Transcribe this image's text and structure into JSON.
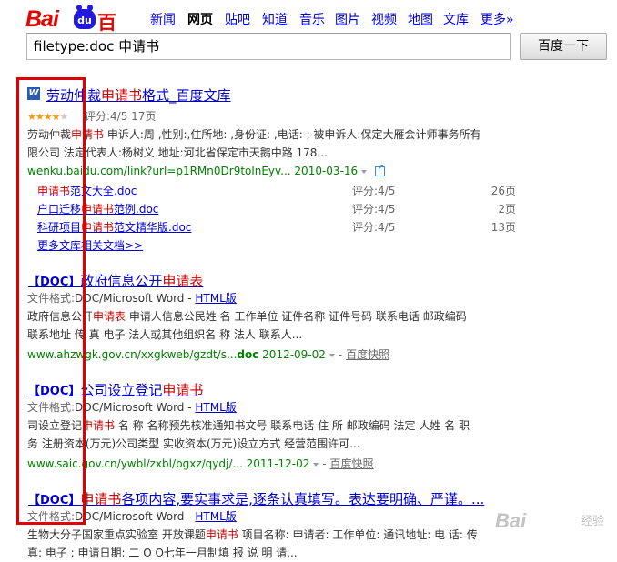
{
  "logo": {
    "bai": "Bai",
    "du": "百度",
    "paw_text": "du"
  },
  "nav": [
    {
      "label": "新闻",
      "current": false
    },
    {
      "label": "网页",
      "current": true
    },
    {
      "label": "贴吧",
      "current": false
    },
    {
      "label": "知道",
      "current": false
    },
    {
      "label": "音乐",
      "current": false
    },
    {
      "label": "图片",
      "current": false
    },
    {
      "label": "视频",
      "current": false
    },
    {
      "label": "地图",
      "current": false
    },
    {
      "label": "文库",
      "current": false
    },
    {
      "label": "更多»",
      "current": false
    }
  ],
  "search": {
    "value": "filetype:doc 申请书",
    "button": "百度一下"
  },
  "result1": {
    "title_pre": "劳动仲裁",
    "title_em": "申请书",
    "title_post": "格式_百度文库",
    "rating": "评分:4/5 17页",
    "stars": {
      "value": 4,
      "max": 5
    },
    "line1_pre": "劳动仲裁",
    "line1_em": "申请书",
    "line1_post": " 申诉人:周 ,性别:,住所地: ,身份证: ,电话: ; 被申诉人:保定大雁会计师事务所有",
    "line2": "限公司 法定代表人:杨树义 地址:河北省保定市天鹅中路 178...",
    "url": "wenku.baidu.com/link?url=p1RMn0Dr9tolnEyv... 2010-03-16",
    "sub": [
      {
        "t_pre": "",
        "t_em": "申请书",
        "t_post": "范文大全.doc",
        "score": "评分:4/5",
        "pages": "26页"
      },
      {
        "t_pre": "户口迁移",
        "t_em": "申请书",
        "t_post": "范例.doc",
        "score": "评分:4/5",
        "pages": "2页"
      },
      {
        "t_pre": "科研项目",
        "t_em": "申请书",
        "t_post": "范文精华版.doc",
        "score": "评分:4/5",
        "pages": "13页"
      }
    ],
    "more": "更多文库相关文档>>"
  },
  "doc_tag": "【DOC】",
  "result2": {
    "title_pre": "政府信息公开",
    "title_em": "申请表",
    "title_post": "",
    "format_label": "文件格式:",
    "format": "DOC/Microsoft Word",
    "sep": " - ",
    "html": "HTML版",
    "line1_pre": "政府信息公开",
    "line1_em": "申请表",
    "line1_post": " 申请人信息公民姓 名 工作单位 证件名称 证件号码 联系电话 邮政编码",
    "line2": "联系地址 传 真 电子 法人或其他组织名 称 法人 联系人...",
    "url_pre": "www.ahzwgk.gov.cn/xxgkweb/gzdt/s...",
    "url_bold": "doc",
    "url_date": " 2012-09-02",
    "snapshot": "百度快照"
  },
  "result3": {
    "title_pre": "公司设立登记",
    "title_em": "申请书",
    "title_post": "",
    "format_label": "文件格式:",
    "format": "DOC/Microsoft Word",
    "sep": " - ",
    "html": "HTML版",
    "line1_pre": "司设立登记",
    "line1_em": "申请书",
    "line1_post": " 名 称 名称预先核准通知书文号 联系电话 住 所 邮政编码 法定 人姓 名 职",
    "line2": "务 注册资本(万元)公司类型 实收资本(万元)设立方式 经营范围许可...",
    "url": "www.saic.gov.cn/ywbl/zxbl/bgxz/qydj/... 2011-12-02",
    "snapshot": "百度快照"
  },
  "result4": {
    "title_pre": "",
    "title_em": "申请书",
    "title_post": "各项内容,要实事求是,逐条认真填写。表达要明确、严谨。...",
    "format_label": "文件格式:",
    "format": "DOC/Microsoft Word",
    "sep": " - ",
    "html": "HTML版",
    "line1_pre": "生物大分子国家重点实验室 开放课题",
    "line1_em": "申请书",
    "line1_post": " 项目名称: 申请者: 工作单位: 通讯地址: 电 话: 传",
    "line2": "真: 电子 : 申请日期: 二 O O七年一月制填 报 说 明 请..."
  },
  "watermark": {
    "logo": "Bai",
    "text": "经验"
  },
  "colors": {
    "link": "#0000cc",
    "highlight": "#cc0000",
    "url": "#008000",
    "annotation_box": "#e00000"
  }
}
